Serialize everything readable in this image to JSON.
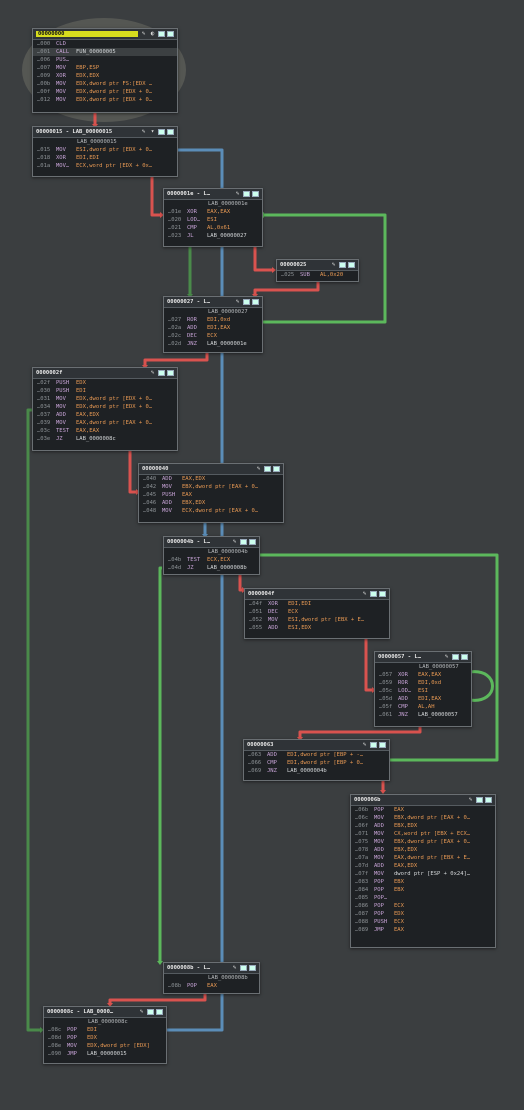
{
  "colors": {
    "background": "#3b3e40",
    "edge_true": "#5cb85c",
    "edge_false": "#d9534f",
    "edge_uncond": "#5b8db8",
    "edge_muted_green": "#4a8a4a",
    "selected_header": "#d7dc1e"
  },
  "nodes": [
    {
      "id": "n0",
      "title": "00000000",
      "label": "",
      "selected": true,
      "lines": [
        [
          "…000",
          "CLD",
          ""
        ],
        [
          "…001",
          "CALL",
          "FUN_00000005"
        ],
        [
          "…006",
          "PUS…",
          ""
        ],
        [
          "…007",
          "MOV",
          "EBP,ESP"
        ],
        [
          "…009",
          "XOR",
          "EDX,EDX"
        ],
        [
          "…00b",
          "MOV",
          "EDX,dword ptr FS:[EDX …"
        ],
        [
          "…00f",
          "MOV",
          "EDX,dword ptr [EDX + 0…"
        ],
        [
          "…012",
          "MOV",
          "EDX,dword ptr [EDX + 0…"
        ]
      ]
    },
    {
      "id": "n15",
      "title": "00000015 - LAB_00000015",
      "label": "LAB_00000015",
      "lines": [
        [
          "…015",
          "MOV",
          "ESI,dword ptr [EDX + 0…"
        ],
        [
          "…018",
          "XOR",
          "EDI,EDI"
        ],
        [
          "…01a",
          "MOV…",
          "ECX,word ptr [EDX + 0x…"
        ]
      ]
    },
    {
      "id": "n1e",
      "title": "0000001e - L…",
      "label": "LAB_0000001e",
      "lines": [
        [
          "…01e",
          "XOR",
          "EAX,EAX"
        ],
        [
          "…020",
          "LOD…",
          "ESI"
        ],
        [
          "…021",
          "CMP",
          "AL,0x61"
        ],
        [
          "…023",
          "JL",
          "LAB_00000027"
        ]
      ]
    },
    {
      "id": "n25",
      "title": "00000025",
      "label": "",
      "lines": [
        [
          "…025",
          "SUB",
          "AL,0x20"
        ]
      ]
    },
    {
      "id": "n27",
      "title": "00000027 - L…",
      "label": "LAB_00000027",
      "lines": [
        [
          "…027",
          "ROR",
          "EDI,0xd"
        ],
        [
          "…02a",
          "ADD",
          "EDI,EAX"
        ],
        [
          "…02c",
          "DEC",
          "ECX"
        ],
        [
          "…02d",
          "JNZ",
          "LAB_0000001e"
        ]
      ]
    },
    {
      "id": "n2f",
      "title": "0000002f",
      "label": "",
      "lines": [
        [
          "…02f",
          "PUSH",
          "EDX"
        ],
        [
          "…030",
          "PUSH",
          "EDI"
        ],
        [
          "…031",
          "MOV",
          "EDX,dword ptr [EDX + 0…"
        ],
        [
          "…034",
          "MOV",
          "EDX,dword ptr [EDX + 0…"
        ],
        [
          "…037",
          "ADD",
          "EAX,EDX"
        ],
        [
          "…039",
          "MOV",
          "EAX,dword ptr [EAX + 0…"
        ],
        [
          "…03c",
          "TEST",
          "EAX,EAX"
        ],
        [
          "…03e",
          "JZ",
          "LAB_0000008c"
        ]
      ]
    },
    {
      "id": "n40",
      "title": "00000040",
      "label": "",
      "lines": [
        [
          "…040",
          "ADD",
          "EAX,EDX"
        ],
        [
          "…042",
          "MOV",
          "EBX,dword ptr [EAX + 0…"
        ],
        [
          "…045",
          "PUSH",
          "EAX"
        ],
        [
          "…046",
          "ADD",
          "EBX,EDX"
        ],
        [
          "…048",
          "MOV",
          "ECX,dword ptr [EAX + 0…"
        ]
      ]
    },
    {
      "id": "n4b",
      "title": "0000004b - L…",
      "label": "LAB_0000004b",
      "lines": [
        [
          "…04b",
          "TEST",
          "ECX,ECX"
        ],
        [
          "…04d",
          "JZ",
          "LAB_0000008b"
        ]
      ]
    },
    {
      "id": "n4f",
      "title": "0000004f",
      "label": "",
      "lines": [
        [
          "…04f",
          "XOR",
          "EDI,EDI"
        ],
        [
          "…051",
          "DEC",
          "ECX"
        ],
        [
          "…052",
          "MOV",
          "ESI,dword ptr [EBX + E…"
        ],
        [
          "…055",
          "ADD",
          "ESI,EDX"
        ]
      ]
    },
    {
      "id": "n57",
      "title": "00000057 - L…",
      "label": "LAB_00000057",
      "lines": [
        [
          "…057",
          "XOR",
          "EAX,EAX"
        ],
        [
          "…059",
          "ROR",
          "EDI,0xd"
        ],
        [
          "…05c",
          "LOD…",
          "ESI"
        ],
        [
          "…05d",
          "ADD",
          "EDI,EAX"
        ],
        [
          "…05f",
          "CMP",
          "AL,AH"
        ],
        [
          "…061",
          "JNZ",
          "LAB_00000057"
        ]
      ]
    },
    {
      "id": "n63",
      "title": "00000063",
      "label": "",
      "lines": [
        [
          "…063",
          "ADD",
          "EDI,dword ptr [EBP + -…"
        ],
        [
          "…066",
          "CMP",
          "EDI,dword ptr [EBP + 0…"
        ],
        [
          "…069",
          "JNZ",
          "LAB_0000004b"
        ]
      ]
    },
    {
      "id": "n6b",
      "title": "0000006b",
      "label": "",
      "lines": [
        [
          "…06b",
          "POP",
          "EAX"
        ],
        [
          "…06c",
          "MOV",
          "EBX,dword ptr [EAX + 0…"
        ],
        [
          "…06f",
          "ADD",
          "EBX,EDX"
        ],
        [
          "…071",
          "MOV",
          "CX,word ptr [EBX + ECX…"
        ],
        [
          "…075",
          "MOV",
          "EBX,dword ptr [EAX + 0…"
        ],
        [
          "…078",
          "ADD",
          "EBX,EDX"
        ],
        [
          "…07a",
          "MOV",
          "EAX,dword ptr [EBX + E…"
        ],
        [
          "…07d",
          "ADD",
          "EAX,EDX"
        ],
        [
          "…07f",
          "MOV",
          "dword ptr [ESP + 0x24]…"
        ],
        [
          "…083",
          "POP",
          "EBX"
        ],
        [
          "…084",
          "POP",
          "EBX"
        ],
        [
          "…085",
          "POP…",
          ""
        ],
        [
          "…086",
          "POP",
          "ECX"
        ],
        [
          "…087",
          "POP",
          "EDX"
        ],
        [
          "…088",
          "PUSH",
          "ECX"
        ],
        [
          "…089",
          "JMP",
          "EAX"
        ]
      ]
    },
    {
      "id": "n8b",
      "title": "0000008b - L…",
      "label": "LAB_0000008b",
      "lines": [
        [
          "…08b",
          "POP",
          "EAX"
        ]
      ]
    },
    {
      "id": "n8c",
      "title": "0000008c - LAB_0000…",
      "label": "LAB_0000008c",
      "lines": [
        [
          "…08c",
          "POP",
          "EDI"
        ],
        [
          "…08d",
          "POP",
          "EDX"
        ],
        [
          "…08e",
          "MOV",
          "EDX,dword ptr [EDX]"
        ],
        [
          "…090",
          "JMP",
          "LAB_00000015"
        ]
      ]
    }
  ]
}
